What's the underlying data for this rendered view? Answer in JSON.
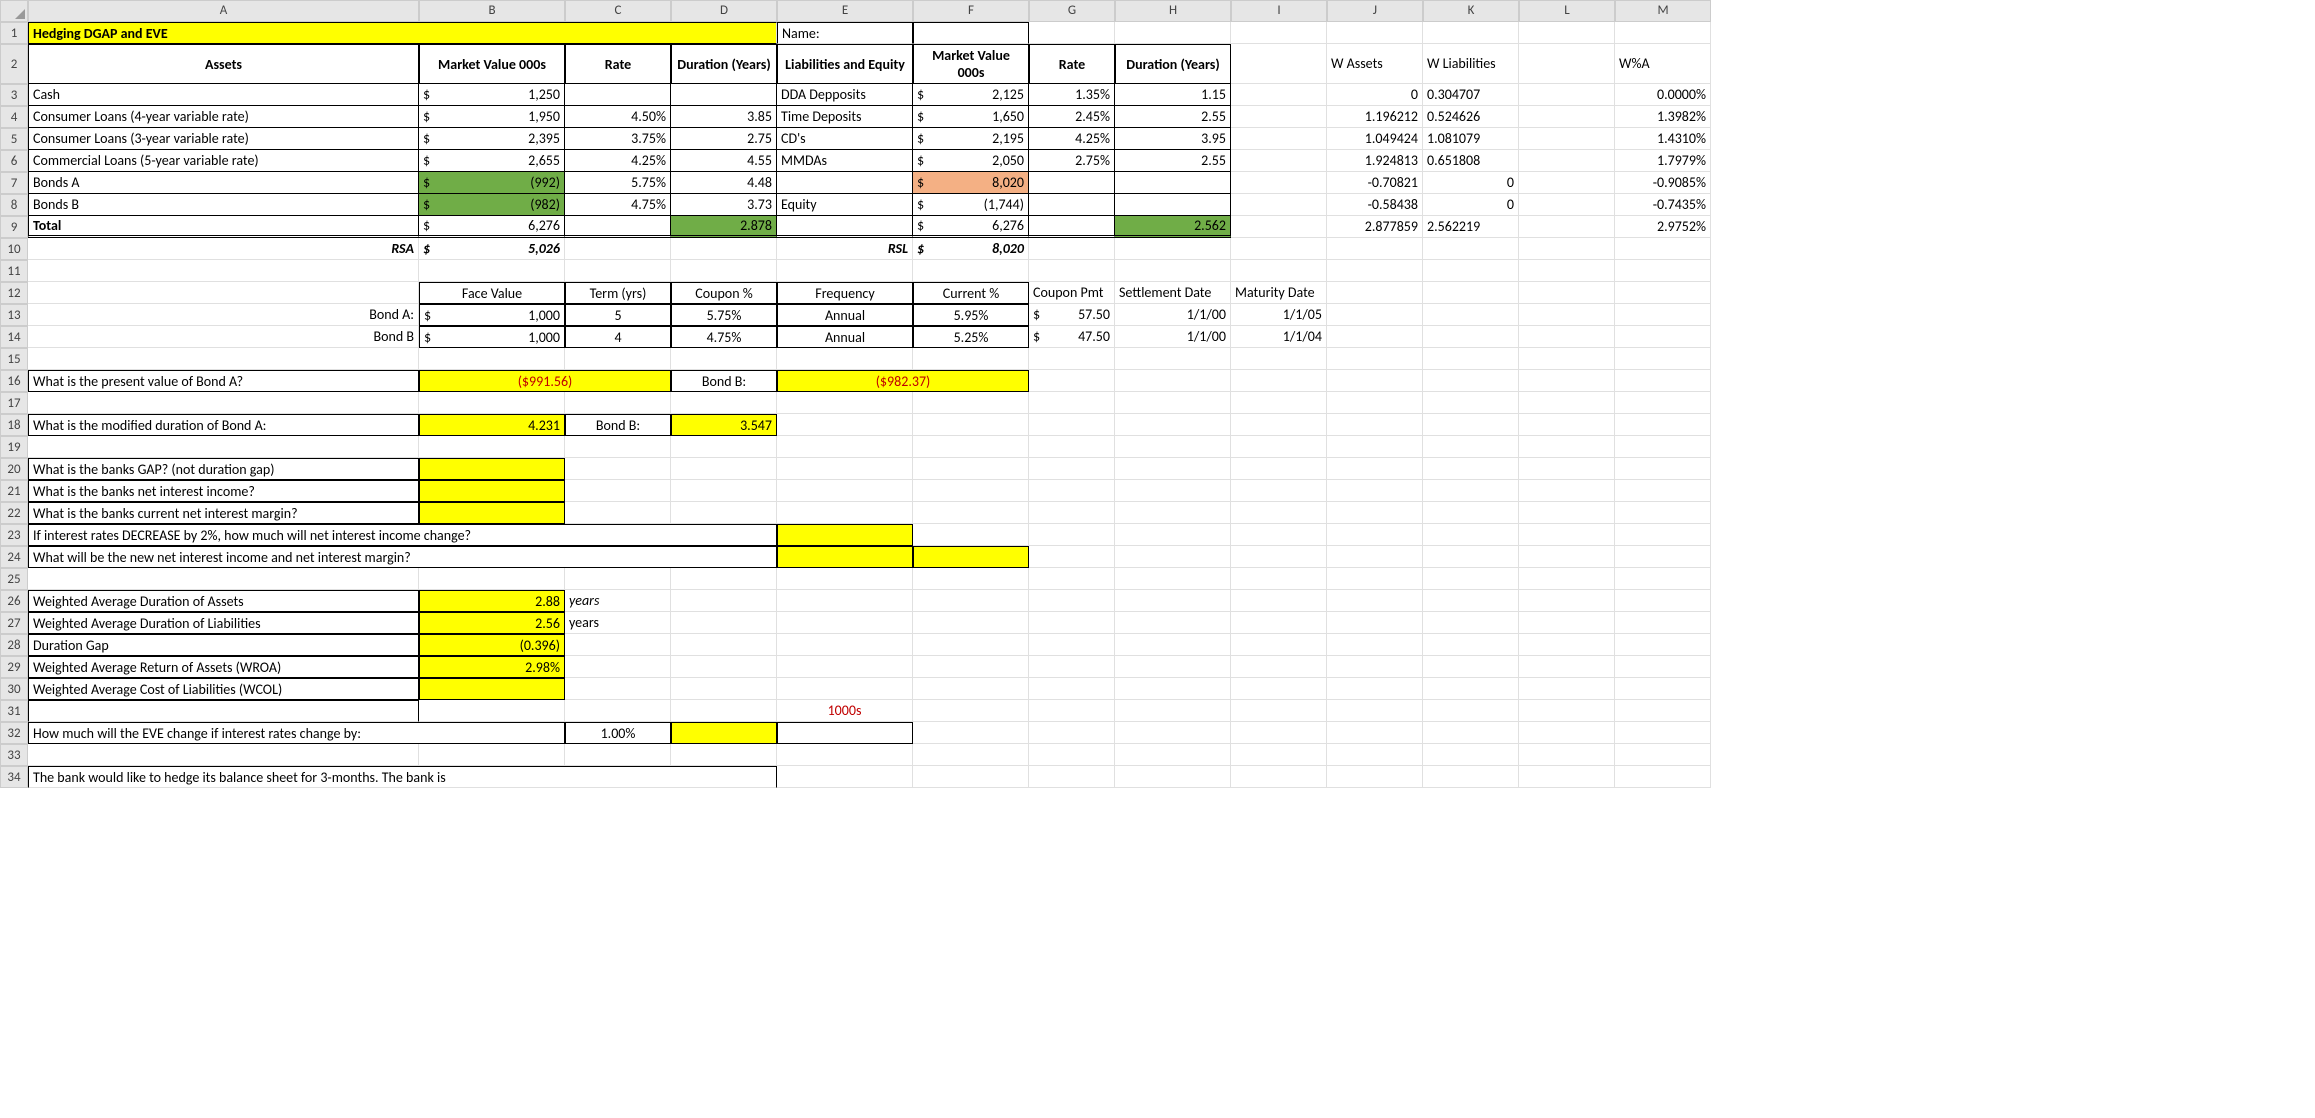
{
  "col_headers": [
    "A",
    "B",
    "C",
    "D",
    "E",
    "F",
    "G",
    "H",
    "I",
    "J",
    "K",
    "L",
    "M"
  ],
  "rows": [
    "1",
    "2",
    "3",
    "4",
    "5",
    "6",
    "7",
    "8",
    "9",
    "10",
    "11",
    "12",
    "13",
    "14",
    "15",
    "16",
    "17",
    "18",
    "19",
    "20",
    "21",
    "22",
    "23",
    "24",
    "25",
    "26",
    "27",
    "28",
    "29",
    "30",
    "31",
    "32",
    "33",
    "34"
  ],
  "r1": {
    "a": "Hedging DGAP and EVE",
    "e": "Name:"
  },
  "r2": {
    "a": "Assets",
    "b": "Market Value 000s",
    "c": "Rate",
    "d": "Duration (Years)",
    "e": "Liabilities and Equity",
    "f": "Market Value 000s",
    "g": "Rate",
    "h": "Duration (Years)",
    "j": "W Assets",
    "k": "W Liabilities",
    "m": "W%A"
  },
  "r3": {
    "a": "Cash",
    "b": "1,250",
    "e": "DDA Depposits",
    "f": "2,125",
    "g": "1.35%",
    "h": "1.15",
    "j": "0",
    "k": "0.304707",
    "m": "0.0000%"
  },
  "r4": {
    "a": "Consumer Loans (4-year variable rate)",
    "b": "1,950",
    "c": "4.50%",
    "d": "3.85",
    "e": "Time Deposits",
    "f": "1,650",
    "g": "2.45%",
    "h": "2.55",
    "j": "1.196212",
    "k": "0.524626",
    "m": "1.3982%"
  },
  "r5": {
    "a": "Consumer Loans (3-year variable rate)",
    "b": "2,395",
    "c": "3.75%",
    "d": "2.75",
    "e": "CD's",
    "f": "2,195",
    "g": "4.25%",
    "h": "3.95",
    "j": "1.049424",
    "k": "1.081079",
    "m": "1.4310%"
  },
  "r6": {
    "a": "Commercial Loans (5-year variable rate)",
    "b": "2,655",
    "c": "4.25%",
    "d": "4.55",
    "e": "MMDAs",
    "f": "2,050",
    "g": "2.75%",
    "h": "2.55",
    "j": "1.924813",
    "k": "0.651808",
    "m": "1.7979%"
  },
  "r7": {
    "a": "Bonds A",
    "b": "(992)",
    "c": "5.75%",
    "d": "4.48",
    "f": "8,020",
    "j": "-0.70821",
    "k": "0",
    "m": "-0.9085%"
  },
  "r8": {
    "a": "Bonds B",
    "b": "(982)",
    "c": "4.75%",
    "d": "3.73",
    "e": "Equity",
    "f": "(1,744)",
    "j": "-0.58438",
    "k": "0",
    "m": "-0.7435%"
  },
  "r9": {
    "a": "Total",
    "b": "6,276",
    "d": "2.878",
    "f": "6,276",
    "h": "2.562",
    "j": "2.877859",
    "k": "2.562219",
    "m": "2.9752%"
  },
  "r10": {
    "a": "RSA",
    "b": "5,026",
    "e": "RSL",
    "f": "8,020"
  },
  "r12": {
    "b": "Face Value",
    "c": "Term (yrs)",
    "d": "Coupon %",
    "e": "Frequency",
    "f": "Current %",
    "g": "Coupon Pmt",
    "h": "Settlement Date",
    "i": "Maturity Date"
  },
  "r13": {
    "a": "Bond A:",
    "b": "1,000",
    "c": "5",
    "d": "5.75%",
    "e": "Annual",
    "f": "5.95%",
    "g": "57.50",
    "h": "1/1/00",
    "i": "1/1/05"
  },
  "r14": {
    "a": "Bond B",
    "b": "1,000",
    "c": "4",
    "d": "4.75%",
    "e": "Annual",
    "f": "5.25%",
    "g": "47.50",
    "h": "1/1/00",
    "i": "1/1/04"
  },
  "r16": {
    "a": "What is the present value of Bond A?",
    "b": "($991.56)",
    "d": "Bond B:",
    "e": "($982.37)"
  },
  "r18": {
    "a": "What is the modified duration of Bond A:",
    "b": "4.231",
    "c": "Bond B:",
    "d": "3.547"
  },
  "r20": {
    "a": "What is the banks GAP?  (not duration gap)"
  },
  "r21": {
    "a": "What is the banks net interest income?"
  },
  "r22": {
    "a": "What is the banks current net interest margin?"
  },
  "r23": {
    "a": "If interest rates DECREASE by 2%, how much will net interest income change?"
  },
  "r24": {
    "a": "What will be the new net interest income and net interest margin?"
  },
  "r26": {
    "a": "Weighted Average Duration of Assets",
    "b": "2.88",
    "c": "years"
  },
  "r27": {
    "a": "Weighted Average Duration of Liabilities",
    "b": "2.56",
    "c": "years"
  },
  "r28": {
    "a": "Duration Gap",
    "b": "(0.396)"
  },
  "r29": {
    "a": "Weighted Average Return of Assets (WROA)",
    "b": "2.98%"
  },
  "r30": {
    "a": "Weighted Average Cost of Liabilities (WCOL)"
  },
  "r31": {
    "e": "1000s"
  },
  "r32": {
    "a": "How much will the EVE change if interest rates change by:",
    "c": "1.00%"
  },
  "r34": {
    "a": "The bank would like to hedge its balance sheet for 3-months. The bank is"
  },
  "chart_data": {
    "type": "table",
    "title": "Hedging DGAP and EVE",
    "assets": [
      {
        "name": "Cash",
        "mv": 1250,
        "rate": null,
        "duration": null
      },
      {
        "name": "Consumer Loans (4-year variable rate)",
        "mv": 1950,
        "rate": 0.045,
        "duration": 3.85
      },
      {
        "name": "Consumer Loans (3-year variable rate)",
        "mv": 2395,
        "rate": 0.0375,
        "duration": 2.75
      },
      {
        "name": "Commercial Loans (5-year variable rate)",
        "mv": 2655,
        "rate": 0.0425,
        "duration": 4.55
      },
      {
        "name": "Bonds A",
        "mv": -992,
        "rate": 0.0575,
        "duration": 4.48
      },
      {
        "name": "Bonds B",
        "mv": -982,
        "rate": 0.0475,
        "duration": 3.73
      }
    ],
    "liabilities": [
      {
        "name": "DDA Depposits",
        "mv": 2125,
        "rate": 0.0135,
        "duration": 1.15
      },
      {
        "name": "Time Deposits",
        "mv": 1650,
        "rate": 0.0245,
        "duration": 2.55
      },
      {
        "name": "CD's",
        "mv": 2195,
        "rate": 0.0425,
        "duration": 3.95
      },
      {
        "name": "MMDAs",
        "mv": 2050,
        "rate": 0.0275,
        "duration": 2.55
      },
      {
        "name": "Equity",
        "mv": -1744,
        "rate": null,
        "duration": null
      }
    ],
    "total_assets": 6276,
    "total_liab": 6276,
    "rsa": 5026,
    "rsl": 8020,
    "asset_dur": 2.878,
    "liab_dur": 2.562,
    "bonds": [
      {
        "name": "Bond A",
        "face": 1000,
        "term": 5,
        "coupon": 0.0575,
        "freq": "Annual",
        "current": 0.0595,
        "pmt": 57.5,
        "settle": "1/1/00",
        "mat": "1/1/05",
        "pv": -991.56,
        "md": 4.231
      },
      {
        "name": "Bond B",
        "face": 1000,
        "term": 4,
        "coupon": 0.0475,
        "freq": "Annual",
        "current": 0.0525,
        "pmt": 47.5,
        "settle": "1/1/00",
        "mat": "1/1/04",
        "pv": -982.37,
        "md": 3.547
      }
    ],
    "wada": 2.88,
    "wadl": 2.56,
    "dgap": -0.396,
    "wroa": 0.0298
  }
}
